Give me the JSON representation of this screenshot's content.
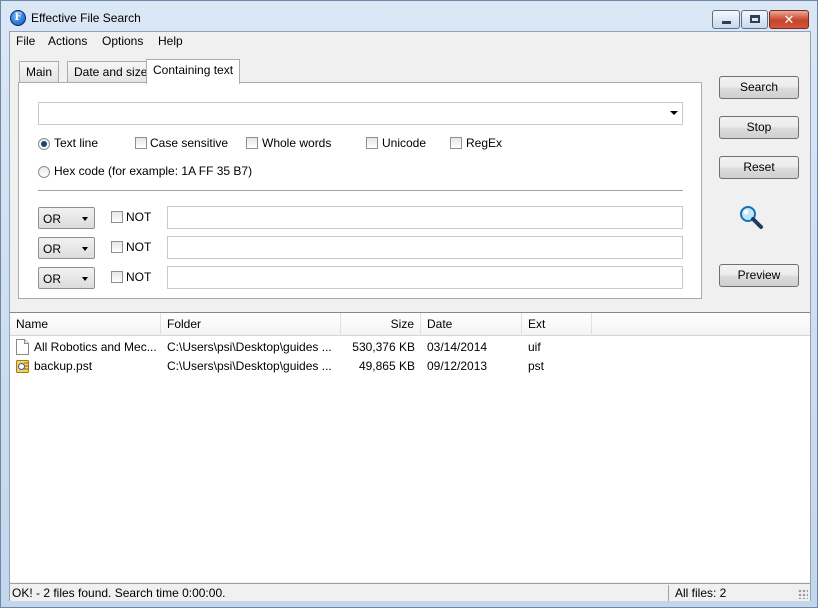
{
  "window": {
    "title": "Effective File Search",
    "icon_letter": "F",
    "close_glyph": "✕"
  },
  "menu": [
    "File",
    "Actions",
    "Options",
    "Help"
  ],
  "tabs": [
    "Main",
    "Date and size",
    "Containing text"
  ],
  "search_text": {
    "value": ""
  },
  "options": {
    "text_line": "Text line",
    "case_sensitive": "Case sensitive",
    "whole_words": "Whole words",
    "unicode": "Unicode",
    "regex": "RegEx",
    "hex_code": "Hex code (for example: 1A FF 35 B7)"
  },
  "conditions": [
    {
      "operator": "OR",
      "not_label": "NOT",
      "value": ""
    },
    {
      "operator": "OR",
      "not_label": "NOT",
      "value": ""
    },
    {
      "operator": "OR",
      "not_label": "NOT",
      "value": ""
    }
  ],
  "buttons": {
    "search": "Search",
    "stop": "Stop",
    "reset": "Reset",
    "preview": "Preview"
  },
  "results": {
    "columns": [
      "Name",
      "Folder",
      "Size",
      "Date",
      "Ext"
    ],
    "rows": [
      {
        "name": "All Robotics and Mec...",
        "folder": "C:\\Users\\psi\\Desktop\\guides ...",
        "size": "530,376 KB",
        "date": "03/14/2014",
        "ext": "uif",
        "icon": "document-icon"
      },
      {
        "name": "backup.pst",
        "folder": "C:\\Users\\psi\\Desktop\\guides ...",
        "size": "49,865 KB",
        "date": "09/12/2013",
        "ext": "pst",
        "icon": "outlook-data-file-icon"
      }
    ]
  },
  "status": {
    "message": "OK! - 2 files found. Search time 0:00:00.",
    "total": "All files: 2"
  },
  "colors": {
    "title_bar": "#c4d6ec",
    "close_button": "#c7432a",
    "panel": "#f0f0f0"
  }
}
